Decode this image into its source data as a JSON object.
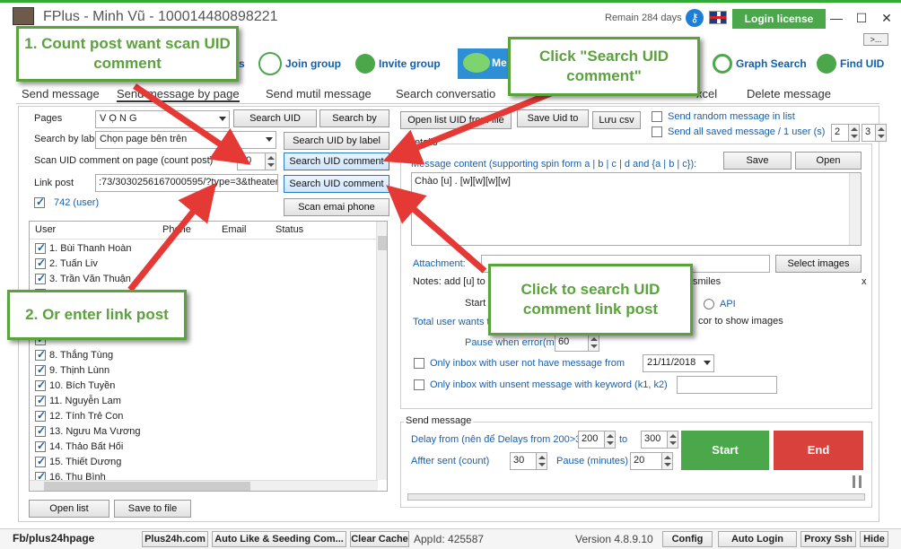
{
  "window": {
    "title": "FPlus - Minh Vũ - 100014480898221",
    "remain": "Remain 284 days",
    "license_btn": "Login license",
    "min": "—",
    "max": "☐",
    "close": "✕",
    "more": ">..."
  },
  "colors": {
    "accent_green": "#4aa84a",
    "end_red": "#d9413d",
    "callout_border": "#5aa23b",
    "arrow_red": "#e53935",
    "link_blue": "#1060b0"
  },
  "toolbar": {
    "items": [
      {
        "label": "s",
        "icon": "message-icon"
      },
      {
        "label": "Join group",
        "icon": "join-group-icon"
      },
      {
        "label": "Invite group",
        "icon": "invite-group-icon"
      },
      {
        "label": "Me",
        "icon": "chat-bubble-icon"
      },
      {
        "label": "Graph Search",
        "icon": "search-icon"
      },
      {
        "label": "Find UID",
        "icon": "find-uid-icon"
      }
    ]
  },
  "tabs": [
    "Send message",
    "Send message by page",
    "Send mutil message",
    "Search conversatio",
    "xcel",
    "Delete message"
  ],
  "left": {
    "pages_label": "Pages",
    "pages_value": "V Ọ N G",
    "search_uid": "Search UID",
    "search_by": "Search by",
    "search_by_label_label": "Search by labe",
    "search_by_label_value": "Chọn page bên trên",
    "search_uid_by_label": "Search UID by label",
    "scan_label": "Scan UID comment on page (count post)",
    "scan_count": "10",
    "search_uid_comment_1": "Search UID comment",
    "link_post_label": "Link post",
    "link_post_value": ":73/3030256167000595/?type=3&theater",
    "search_uid_comment_2": "Search UID comment",
    "user_count": "742 (user)",
    "scan_email_phone": "Scan emai phone",
    "columns": [
      "User",
      "Phone",
      "Email",
      "Status"
    ],
    "users": [
      "1. Bùi Thanh Hoàn",
      "2. Tuấn Liv",
      "3. Trần Văn Thuận",
      "",
      "",
      "",
      "",
      "8. Thắng Tùng",
      "9. Thịnh Lùnn",
      "10. Bích Tuyền",
      "11. Nguyễn Lam",
      "12. Tính Trẻ Con",
      "13. Ngưu Ma Vương",
      "14. Thảo Bất Hối",
      "15. Thiết Dương",
      "16. Thu Bình"
    ],
    "open_list": "Open list",
    "save_to_file": "Save to file"
  },
  "right": {
    "open_list_uid": "Open list UID from file",
    "save_uid_to": "Save Uid to",
    "luu_csv": "Lưu csv",
    "send_random": "Send random message in list",
    "send_all_saved": "Send all saved message / 1 user (s)",
    "spin_a": "2",
    "spin_b": "3",
    "details": "Details",
    "message_content_label": "Message content (supporting spin form a | b | c | d and {a | b | c}):",
    "save": "Save",
    "open": "Open",
    "message_text": "Chào [u] . [w][w][w][w]",
    "attachment": "Attachment:",
    "select_images": "Select images",
    "notes": "Notes: add [u] to i",
    "smiles": "smiles",
    "notes_x": "x",
    "start_label": "Start i",
    "api": "API",
    "total_user": "Total user wants t",
    "show_images": "cor to show images",
    "pause_error_label": "Pause when error(m)",
    "pause_error_value": "60",
    "only_inbox_label": "Only inbox with user not have message from",
    "only_inbox_date": "21/11/2018",
    "unsent_label": "Only inbox with unsent message with keyword (k1, k2)"
  },
  "send": {
    "group_title": "Send message",
    "delay_label": "Delay from (nên để Delays from 200>30",
    "delay_from": "200",
    "to_label": "to",
    "delay_to": "300",
    "after_sent_label": "Affter sent (count)",
    "after_sent_value": "30",
    "pause_label": "Pause (minutes)",
    "pause_value": "20",
    "start": "Start",
    "end": "End"
  },
  "statusbar": {
    "fb": "Fb/plus24hpage",
    "plus24h": "Plus24h.com",
    "auto_like": "Auto Like & Seeding Com...",
    "clear_cache": "Clear Cache",
    "appid": "AppId: 425587",
    "version": "Version 4.8.9.10",
    "config": "Config",
    "auto_login": "Auto Login",
    "proxy": "Proxy Ssh",
    "hide": "Hide"
  },
  "callouts": {
    "c1": "1. Count post want scan UID comment",
    "c2": "2. Or enter link post",
    "c3": "Click \"Search UID comment\"",
    "c4": "Click to search UID comment link post"
  }
}
